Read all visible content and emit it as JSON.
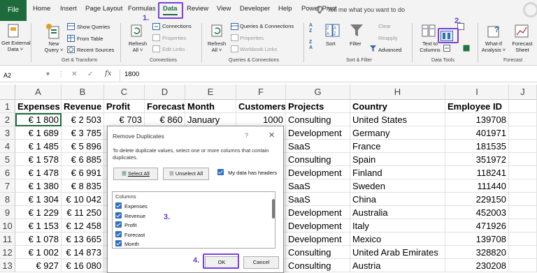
{
  "ribbon_tabs": [
    "File",
    "Home",
    "Insert",
    "Page Layout",
    "Formulas",
    "Data",
    "Review",
    "View",
    "Developer",
    "Help",
    "Power Pivot"
  ],
  "active_tab": "Data",
  "tell_me": "Tell me what you want to do",
  "ribbon": {
    "get_external": [
      "Get External",
      "Data ˅"
    ],
    "new_query": [
      "New",
      "Query ˅"
    ],
    "show_queries": "Show Queries",
    "from_table": "From Table",
    "recent_sources": "Recent Sources",
    "group_get_transform": "Get & Transform",
    "refresh_all": [
      "Refresh",
      "All ˅"
    ],
    "connections": "Connections",
    "properties": "Properties",
    "edit_links": "Edit Links",
    "group_connections": "Connections",
    "refresh_all2": [
      "Refresh",
      "All ˅"
    ],
    "queries_connections": "Queries & Connections",
    "properties2": "Properties",
    "workbook_links": "Workbook Links",
    "group_queries": "Queries & Connections",
    "sort": "Sort",
    "filter": "Filter",
    "clear": "Clear",
    "reapply": "Reapply",
    "advanced": "Advanced",
    "group_sort_filter": "Sort & Filter",
    "text_to_columns": [
      "Text to",
      "Columns"
    ],
    "group_data_tools": "Data Tools",
    "what_if": [
      "What-If",
      "Analysis ˅"
    ],
    "forecast_sheet": [
      "Forecast",
      "Sheet"
    ],
    "group_forecast": "Forecast"
  },
  "formula_bar": {
    "name_box": "A2",
    "fx": "fx",
    "value": "1800"
  },
  "columns": [
    "A",
    "B",
    "C",
    "D",
    "E",
    "F",
    "G",
    "H",
    "I",
    "J"
  ],
  "rows": [
    [
      "Expenses",
      "Revenue",
      "Profit",
      "Forecast",
      "Month",
      "Customers",
      "Projects",
      "Country",
      "Employee ID",
      ""
    ],
    [
      "€ 1 800",
      "€ 2 503",
      "€ 703",
      "€ 860",
      "January",
      "1000",
      "Consulting",
      "United States",
      "139708",
      ""
    ],
    [
      "€ 1 689",
      "€ 3 785",
      "",
      "",
      "",
      "",
      "Development",
      "Germany",
      "401971",
      ""
    ],
    [
      "€ 1 485",
      "€ 5 896",
      "",
      "",
      "",
      "",
      "SaaS",
      "France",
      "181535",
      ""
    ],
    [
      "€ 1 578",
      "€ 6 885",
      "",
      "",
      "",
      "",
      "Consulting",
      "Spain",
      "351972",
      ""
    ],
    [
      "€ 1 478",
      "€ 6 991",
      "",
      "",
      "",
      "",
      "Development",
      "Finland",
      "118241",
      ""
    ],
    [
      "€ 1 380",
      "€ 8 835",
      "",
      "",
      "",
      "",
      "SaaS",
      "Sweden",
      "111440",
      ""
    ],
    [
      "€ 1 304",
      "€ 10 042",
      "",
      "",
      "",
      "",
      "SaaS",
      "China",
      "229150",
      ""
    ],
    [
      "€ 1 229",
      "€ 11 250",
      "€",
      "",
      "",
      "",
      "Development",
      "Australia",
      "452003",
      ""
    ],
    [
      "€ 1 153",
      "€ 12 458",
      "€",
      "",
      "",
      "",
      "Development",
      "Italy",
      "471926",
      ""
    ],
    [
      "€ 1 078",
      "€ 13 665",
      "€",
      "",
      "",
      "",
      "Development",
      "Mexico",
      "139708",
      ""
    ],
    [
      "€ 1 002",
      "€ 14 873",
      "€",
      "",
      "",
      "",
      "Consulting",
      "United Arab Emirates",
      "328820",
      ""
    ],
    [
      "€ 927",
      "€ 16 080",
      "",
      "",
      "",
      "",
      "Consulting",
      "Austria",
      "230208",
      ""
    ]
  ],
  "row_numbers": [
    "1",
    "2",
    "3",
    "4",
    "5",
    "6",
    "7",
    "8",
    "9",
    "10",
    "11",
    "12",
    "13"
  ],
  "dialog": {
    "title": "Remove Duplicates",
    "help": "?",
    "close": "✕",
    "instructions": "To delete duplicate values, select one or more columns that contain duplicates.",
    "select_all": "Select All",
    "unselect_all": "Unselect All",
    "headers_checkbox": "My data has headers",
    "columns_caption": "Columns",
    "columns": [
      "Expenses",
      "Revenue",
      "Profit",
      "Forecast",
      "Month"
    ],
    "ok": "OK",
    "cancel": "Cancel"
  },
  "annotations": [
    "1.",
    "2.",
    "3.",
    "4."
  ],
  "colors": {
    "excel_green": "#1d6b3a",
    "annotation_purple": "#7b3fe0",
    "checkbox_blue": "#2f6fbf"
  }
}
